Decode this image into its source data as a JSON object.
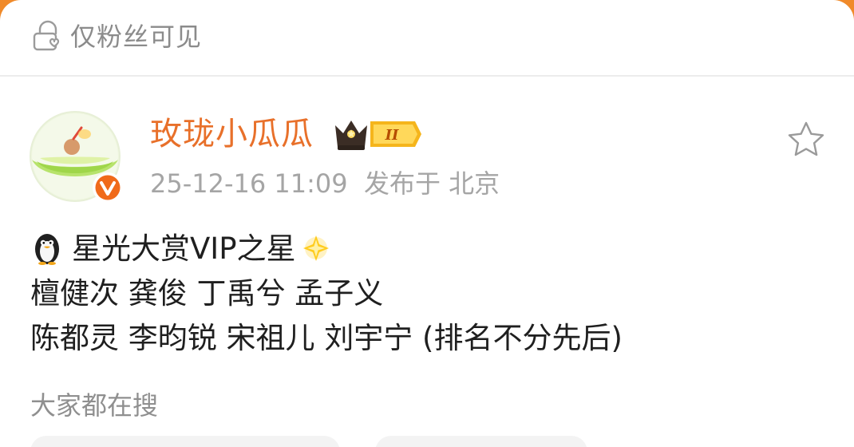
{
  "header": {
    "visibility_label": "仅粉丝可见"
  },
  "post": {
    "username": "玫珑小瓜瓜",
    "vip_level": "II",
    "timestamp": "25-12-16 11:09",
    "published_from": "发布于 北京",
    "lines": [
      "星光大赏VIP之星",
      "檀健次 龚俊 丁禹兮 孟子义",
      "陈都灵 李昀锐 宋祖儿 刘宇宁 (排名不分先后)"
    ]
  },
  "section": {
    "hot_search_title": "大家都在搜"
  },
  "icons": {
    "visibility": "lock-icon",
    "vip": "crown-badge",
    "verified": "verified-v-icon",
    "favorite": "star-outline-icon",
    "emoji_1": "penguin-icon",
    "emoji_2": "sparkle-star-icon"
  },
  "colors": {
    "username": "#e8702a",
    "verified_badge": "#f06a1a",
    "vip_gold": "#f5b51c",
    "gray_text": "#8b8b8b",
    "bg_accent": "#f08a2a"
  }
}
